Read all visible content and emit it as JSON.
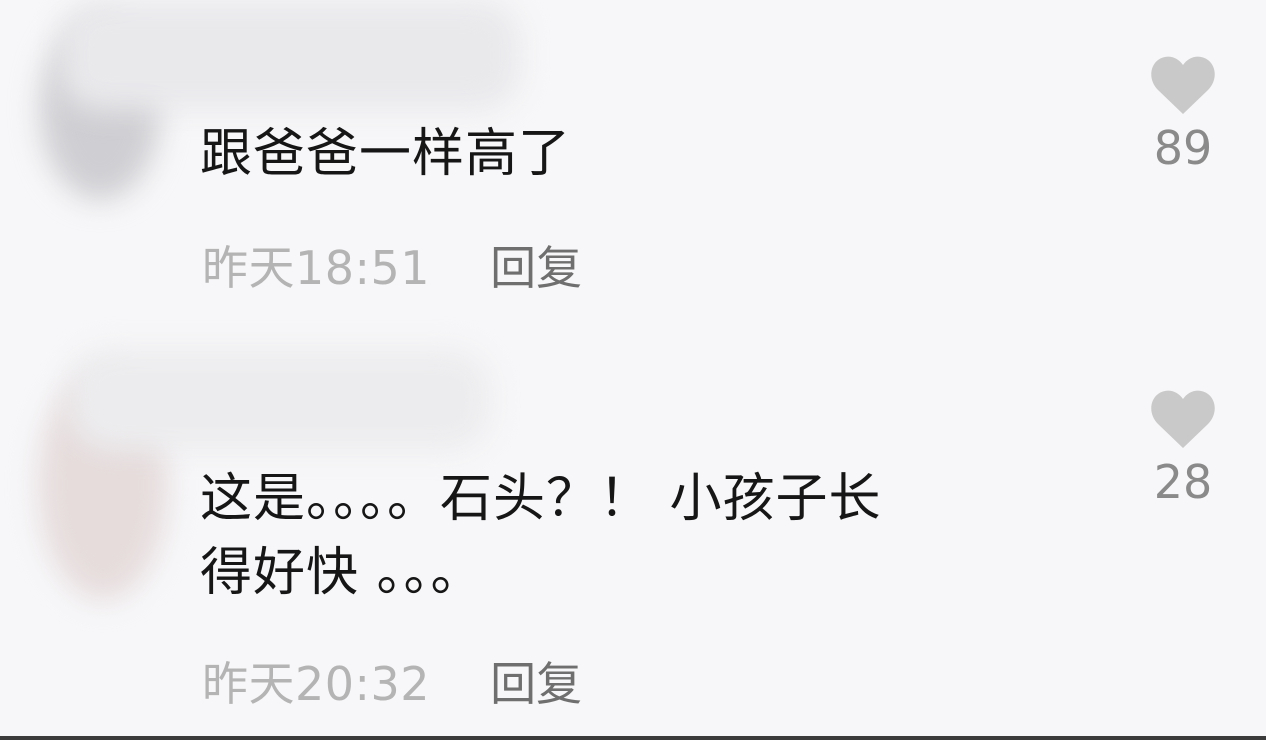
{
  "comments": [
    {
      "text": "跟爸爸一样高了",
      "time": "昨天18:51",
      "reply_label": "回复",
      "like_count": "89"
    },
    {
      "text": "这是。。。。石头？！ 小孩子长\n得好快 。。。",
      "time": "昨天20:32",
      "reply_label": "回复",
      "like_count": "28"
    }
  ],
  "colors": {
    "background": "#f7f7f9",
    "text": "#161616",
    "meta": "#b4b4b4",
    "reply": "#6f6f6f",
    "heart": "#c9c9c9",
    "count": "#8a8a8a"
  },
  "icons": {
    "like": "heart-icon"
  }
}
